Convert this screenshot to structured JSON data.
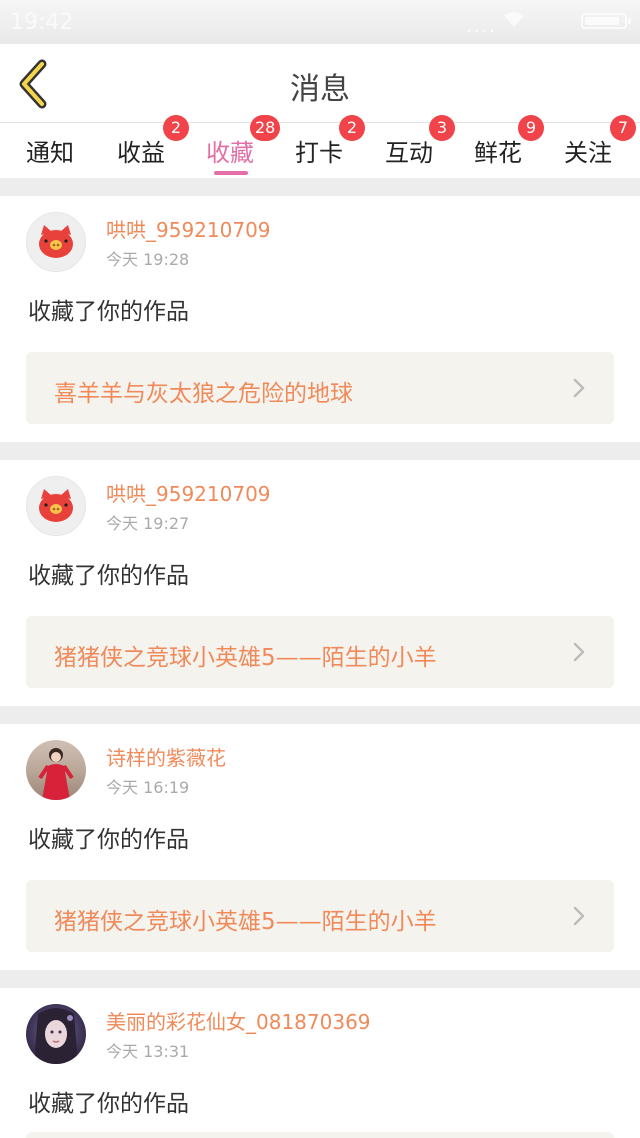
{
  "status_bar": {
    "time": "19:42",
    "signal": "....",
    "wifi_icon": "wifi-icon",
    "battery_level": 0.9
  },
  "header": {
    "title": "消息",
    "back_icon": "chevron-left-icon"
  },
  "tabs": [
    {
      "label": "通知",
      "badge": ""
    },
    {
      "label": "收益",
      "badge": "2"
    },
    {
      "label": "收藏",
      "badge": "28",
      "active": true
    },
    {
      "label": "打卡",
      "badge": "2"
    },
    {
      "label": "互动",
      "badge": "3"
    },
    {
      "label": "鲜花",
      "badge": "9"
    },
    {
      "label": "关注",
      "badge": "7"
    }
  ],
  "messages": [
    {
      "username": "哄哄_959210709",
      "time": "今天 19:28",
      "action": "收藏了你的作品",
      "work_title": "喜羊羊与灰太狼之危险的地球",
      "avatar": "pig-avatar"
    },
    {
      "username": "哄哄_959210709",
      "time": "今天 19:27",
      "action": "收藏了你的作品",
      "work_title": "猪猪侠之竞球小英雄5——陌生的小羊",
      "avatar": "pig-avatar"
    },
    {
      "username": "诗样的紫薇花",
      "time": "今天 16:19",
      "action": "收藏了你的作品",
      "work_title": "猪猪侠之竞球小英雄5——陌生的小羊",
      "avatar": "girl-photo-avatar"
    },
    {
      "username": "美丽的彩花仙女_081870369",
      "time": "今天 13:31",
      "action": "收藏了你的作品",
      "work_title": "",
      "avatar": "fairy-photo-avatar"
    }
  ],
  "colors": {
    "accent": "#e46fa6",
    "username": "#f08a5a",
    "badge": "#f0434a",
    "card_bg": "#f4f3ee"
  }
}
